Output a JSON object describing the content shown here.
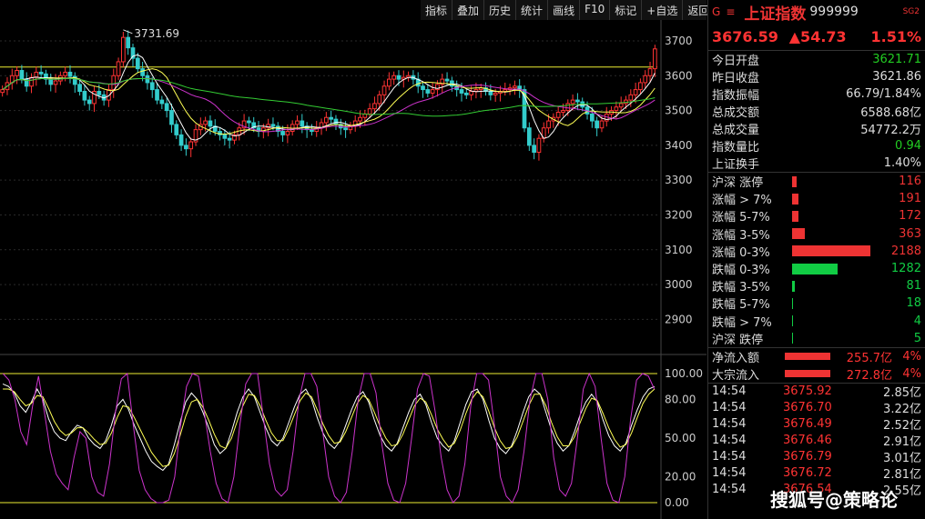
{
  "toolbar": [
    "指标",
    "叠加",
    "历史",
    "统计",
    "画线",
    "F10",
    "标记",
    "+自选",
    "返回"
  ],
  "header": {
    "g_icon": "G",
    "menu_icon": "≡",
    "name": "上证指数",
    "code": "999999",
    "tag": "SG2"
  },
  "quote": {
    "price": "3676.59",
    "change": "▲54.73",
    "pct": "1.51%"
  },
  "stats": [
    {
      "label": "今日开盘",
      "value": "3621.71",
      "color": "green"
    },
    {
      "label": "昨日收盘",
      "value": "3621.86",
      "color": "white"
    },
    {
      "label": "指数振幅",
      "value": "66.79/1.84%",
      "color": "white"
    },
    {
      "label": "总成交额",
      "value": "6588.68亿",
      "color": "white"
    },
    {
      "label": "总成交量",
      "value": "54772.2万",
      "color": "white"
    },
    {
      "label": "指数量比",
      "value": "0.94",
      "color": "green"
    },
    {
      "label": "上证换手",
      "value": "1.40%",
      "color": "white"
    }
  ],
  "breadth": [
    {
      "label": "沪深 涨停",
      "value": "116",
      "frac": 0.053,
      "color": "#e33"
    },
    {
      "label": "涨幅 > 7%",
      "value": "191",
      "frac": 0.087,
      "color": "#e33"
    },
    {
      "label": "涨幅 5-7%",
      "value": "172",
      "frac": 0.079,
      "color": "#e33"
    },
    {
      "label": "涨幅 3-5%",
      "value": "363",
      "frac": 0.166,
      "color": "#e33"
    },
    {
      "label": "涨幅 0-3%",
      "value": "2188",
      "frac": 1.0,
      "color": "#e33"
    },
    {
      "label": "跌幅 0-3%",
      "value": "1282",
      "frac": 0.586,
      "color": "#1c4"
    },
    {
      "label": "跌幅 3-5%",
      "value": "81",
      "frac": 0.037,
      "color": "#1c4"
    },
    {
      "label": "跌幅 5-7%",
      "value": "18",
      "frac": 0.008,
      "color": "#1c4"
    },
    {
      "label": "跌幅 > 7%",
      "value": "4",
      "frac": 0.002,
      "color": "#1c4"
    },
    {
      "label": "沪深 跌停",
      "value": "5",
      "frac": 0.002,
      "color": "#1c4"
    }
  ],
  "flows": [
    {
      "label": "净流入额",
      "value": "255.7亿",
      "pct": "4%"
    },
    {
      "label": "大宗流入",
      "value": "272.8亿",
      "pct": "4%"
    }
  ],
  "ticks": [
    {
      "time": "14:54",
      "price": "3675.92",
      "vol": "2.85亿"
    },
    {
      "time": "14:54",
      "price": "3676.70",
      "vol": "3.22亿"
    },
    {
      "time": "14:54",
      "price": "3676.49",
      "vol": "2.52亿"
    },
    {
      "time": "14:54",
      "price": "3676.46",
      "vol": "2.91亿"
    },
    {
      "time": "14:54",
      "price": "3676.79",
      "vol": "3.01亿"
    },
    {
      "time": "14:54",
      "price": "3676.72",
      "vol": "2.81亿"
    },
    {
      "time": "14:54",
      "price": "3676.54",
      "vol": "2.55亿"
    }
  ],
  "watermark": "搜狐号@策略论",
  "chart_data": [
    {
      "type": "candlestick",
      "title": "上证指数",
      "ylim": [
        2820,
        3760
      ],
      "y_ticks": [
        3700,
        3600,
        3500,
        3400,
        3300,
        3200,
        3100,
        3000,
        2900
      ],
      "high_annotation": "3731.69",
      "reference_line": 3625,
      "series": [
        {
          "name": "close",
          "values": [
            3560,
            3580,
            3600,
            3615,
            3590,
            3570,
            3595,
            3610,
            3605,
            3590,
            3575,
            3585,
            3600,
            3610,
            3598,
            3575,
            3555,
            3530,
            3520,
            3555,
            3545,
            3530,
            3560,
            3600,
            3640,
            3710,
            3680,
            3650,
            3620,
            3600,
            3580,
            3560,
            3530,
            3520,
            3500,
            3460,
            3430,
            3400,
            3390,
            3410,
            3445,
            3460,
            3470,
            3455,
            3440,
            3430,
            3420,
            3415,
            3430,
            3450,
            3470,
            3465,
            3450,
            3440,
            3450,
            3460,
            3455,
            3440,
            3430,
            3440,
            3460,
            3470,
            3455,
            3445,
            3440,
            3450,
            3465,
            3480,
            3475,
            3460,
            3450,
            3445,
            3455,
            3470,
            3480,
            3490,
            3505,
            3520,
            3545,
            3570,
            3590,
            3600,
            3590,
            3595,
            3600,
            3590,
            3570,
            3560,
            3550,
            3560,
            3575,
            3590,
            3585,
            3570,
            3560,
            3550,
            3545,
            3555,
            3560,
            3565,
            3555,
            3545,
            3550,
            3555,
            3560,
            3565,
            3570,
            3560,
            3450,
            3400,
            3380,
            3420,
            3450,
            3470,
            3480,
            3495,
            3500,
            3520,
            3530,
            3525,
            3510,
            3490,
            3470,
            3450,
            3470,
            3490,
            3500,
            3510,
            3520,
            3530,
            3545,
            3560,
            3580,
            3600,
            3620,
            3677
          ]
        }
      ]
    },
    {
      "type": "line",
      "title": "",
      "ylim": [
        0,
        100
      ],
      "y_ticks": [
        100,
        80,
        50,
        20,
        0
      ],
      "reference_lines": [
        100,
        0
      ],
      "series": [
        {
          "name": "",
          "color": "#ffffff",
          "values": [
            92,
            90,
            85,
            75,
            70,
            78,
            88,
            80,
            65,
            55,
            50,
            48,
            55,
            60,
            58,
            50,
            45,
            42,
            48,
            60,
            75,
            80,
            72,
            60,
            50,
            40,
            32,
            28,
            25,
            30,
            45,
            62,
            78,
            85,
            80,
            70,
            58,
            45,
            38,
            42,
            55,
            70,
            82,
            88,
            82,
            70,
            58,
            48,
            44,
            50,
            62,
            74,
            84,
            88,
            80,
            66,
            54,
            46,
            42,
            48,
            60,
            72,
            82,
            86,
            78,
            64,
            52,
            44,
            40,
            46,
            58,
            70,
            80,
            84,
            76,
            62,
            50,
            44,
            40,
            48,
            62,
            76,
            86,
            88,
            80,
            64,
            50,
            42,
            38,
            44,
            56,
            70,
            82,
            88,
            84,
            70,
            56,
            46,
            40,
            44,
            55,
            68,
            78,
            84,
            78,
            64,
            52,
            44,
            40,
            46,
            60,
            72,
            82,
            88,
            90
          ]
        },
        {
          "name": "",
          "color": "#ffff55",
          "values": [
            88,
            88,
            86,
            80,
            75,
            77,
            83,
            82,
            73,
            63,
            56,
            52,
            54,
            58,
            58,
            54,
            49,
            45,
            46,
            54,
            66,
            75,
            74,
            66,
            57,
            48,
            39,
            33,
            28,
            29,
            38,
            52,
            67,
            78,
            80,
            74,
            64,
            53,
            44,
            42,
            50,
            63,
            75,
            84,
            83,
            75,
            64,
            54,
            48,
            48,
            57,
            68,
            79,
            85,
            82,
            72,
            61,
            52,
            46,
            47,
            55,
            66,
            77,
            83,
            80,
            70,
            59,
            50,
            44,
            45,
            53,
            64,
            75,
            81,
            78,
            68,
            57,
            49,
            43,
            46,
            56,
            69,
            80,
            86,
            82,
            71,
            58,
            48,
            42,
            43,
            51,
            63,
            75,
            84,
            84,
            75,
            62,
            51,
            44,
            44,
            51,
            62,
            73,
            81,
            79,
            69,
            58,
            49,
            43,
            45,
            54,
            66,
            77,
            84,
            88
          ]
        },
        {
          "name": "",
          "color": "#cc33cc",
          "values": [
            100,
            95,
            80,
            55,
            45,
            75,
            98,
            70,
            40,
            22,
            15,
            10,
            35,
            55,
            50,
            20,
            8,
            5,
            30,
            70,
            96,
            100,
            60,
            25,
            10,
            3,
            0,
            0,
            2,
            20,
            60,
            90,
            100,
            98,
            70,
            40,
            15,
            3,
            0,
            20,
            60,
            92,
            100,
            100,
            65,
            30,
            10,
            5,
            10,
            40,
            80,
            100,
            100,
            90,
            55,
            20,
            5,
            0,
            8,
            40,
            80,
            100,
            100,
            85,
            45,
            15,
            2,
            0,
            15,
            50,
            88,
            100,
            98,
            70,
            35,
            10,
            0,
            5,
            30,
            75,
            100,
            100,
            95,
            60,
            20,
            5,
            0,
            10,
            40,
            80,
            100,
            100,
            80,
            35,
            10,
            5,
            15,
            50,
            88,
            100,
            90,
            50,
            15,
            2,
            0,
            20,
            65,
            95,
            100,
            98,
            88
          ]
        }
      ]
    }
  ]
}
